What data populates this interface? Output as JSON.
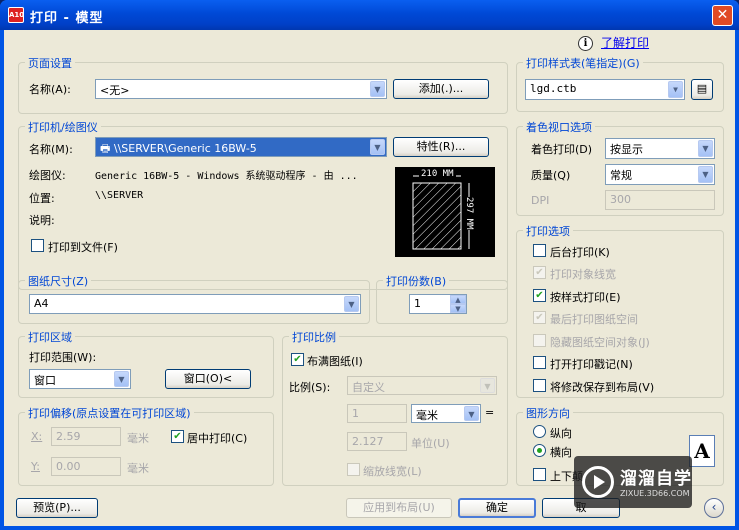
{
  "window": {
    "title": "打印 - 模型",
    "app_icon_text": "A10"
  },
  "help": {
    "link": "了解打印"
  },
  "page_setup": {
    "title": "页面设置",
    "name_label": "名称(A):",
    "name_value": "<无>",
    "add_button": "添加(.)..."
  },
  "printer": {
    "title": "打印机/绘图仪",
    "name_label": "名称(M):",
    "name_value": "\\\\SERVER\\Generic 16BW-5",
    "properties_button": "特性(R)...",
    "plotter_label": "绘图仪:",
    "plotter_value": "Generic 16BW-5 - Windows 系统驱动程序 - 由 ...",
    "location_label": "位置:",
    "location_value": "\\\\SERVER",
    "description_label": "说明:",
    "print_to_file": "打印到文件(F)",
    "paper_width": "210 MM",
    "paper_height": "297 MM"
  },
  "paper_size": {
    "title": "图纸尺寸(Z)",
    "value": "A4"
  },
  "copies": {
    "title": "打印份数(B)",
    "value": "1"
  },
  "print_area": {
    "title": "打印区域",
    "range_label": "打印范围(W):",
    "range_value": "窗口",
    "window_button": "窗口(O)<"
  },
  "print_offset": {
    "title": "打印偏移(原点设置在可打印区域)",
    "x_label": "X:",
    "x_value": "2.59",
    "x_unit": "毫米",
    "y_label": "Y:",
    "y_value": "0.00",
    "y_unit": "毫米",
    "center": "居中打印(C)"
  },
  "print_scale": {
    "title": "打印比例",
    "fit": "布满图纸(I)",
    "scale_label": "比例(S):",
    "scale_value": "自定义",
    "value1": "1",
    "unit_value": "毫米",
    "equals": "=",
    "value2": "2.127",
    "unit_label": "单位(U)",
    "scale_lineweights": "缩放线宽(L)"
  },
  "plot_style": {
    "title": "打印样式表(笔指定)(G)",
    "value": "lgd.ctb"
  },
  "shaded_viewport": {
    "title": "着色视口选项",
    "shade_label": "着色打印(D)",
    "shade_value": "按显示",
    "quality_label": "质量(Q)",
    "quality_value": "常规",
    "dpi_label": "DPI",
    "dpi_value": "300"
  },
  "plot_options": {
    "title": "打印选项",
    "items": [
      {
        "label": "后台打印(K)",
        "checked": false,
        "enabled": true
      },
      {
        "label": "打印对象线宽",
        "checked": true,
        "enabled": false
      },
      {
        "label": "按样式打印(E)",
        "checked": true,
        "enabled": true
      },
      {
        "label": "最后打印图纸空间",
        "checked": true,
        "enabled": false
      },
      {
        "label": "隐藏图纸空间对象(J)",
        "checked": false,
        "enabled": false
      },
      {
        "label": "打开打印戳记(N)",
        "checked": false,
        "enabled": true
      },
      {
        "label": "将修改保存到布局(V)",
        "checked": false,
        "enabled": true
      }
    ]
  },
  "orientation": {
    "title": "图形方向",
    "portrait": "纵向",
    "landscape": "横向",
    "upside_down": "上下颠",
    "preview_letter": "A"
  },
  "footer": {
    "preview": "预览(P)...",
    "apply": "应用到布局(U)",
    "ok": "确定",
    "cancel": "取"
  },
  "watermark": {
    "text": "溜溜自学",
    "url": "ZIXUE.3D66.COM"
  }
}
